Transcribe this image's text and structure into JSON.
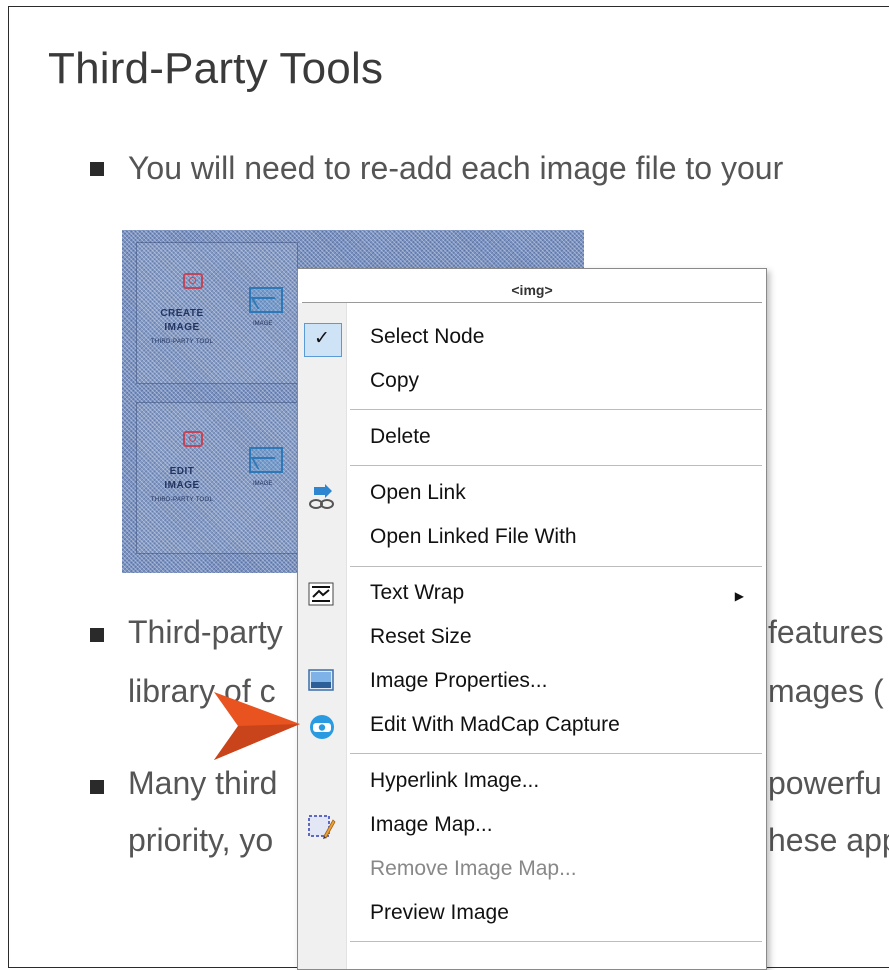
{
  "page": {
    "title": "Third-Party Tools",
    "bullets": [
      "You will need to re-add each image file to your",
      "Third-party",
      "features",
      "library of c",
      "mages (",
      "Many third",
      "powerfu",
      "priority, yo",
      "hese app"
    ]
  },
  "image": {
    "tile1_label_line1": "CREATE",
    "tile1_label_line2": "IMAGE",
    "tile1_sub": "THIRD-PARTY TOOL",
    "tile2_label_line1": "EDIT",
    "tile2_label_line2": "IMAGE",
    "tile2_sub": "THIRD-PARTY TOOL",
    "pic_caption": "IMAGE",
    "selection_color": "#7a93c2"
  },
  "context_menu": {
    "header": "<img>",
    "items": [
      {
        "label": "Select Node",
        "icon": "check-icon",
        "checked": true
      },
      {
        "label": "Copy"
      },
      {
        "label": "Delete"
      },
      {
        "label": "Open Link",
        "icon": "link-icon"
      },
      {
        "label": "Open Linked File With"
      },
      {
        "label": "Text Wrap",
        "icon": "text-wrap-icon",
        "submenu": true
      },
      {
        "label": "Reset Size"
      },
      {
        "label": "Image Properties...",
        "icon": "image-properties-icon"
      },
      {
        "label": "Edit With MadCap Capture",
        "icon": "madcap-capture-icon"
      },
      {
        "label": "Hyperlink Image..."
      },
      {
        "label": "Image Map...",
        "icon": "image-map-icon"
      },
      {
        "label": "Remove Image Map...",
        "disabled": true
      },
      {
        "label": "Preview Image"
      }
    ],
    "submenu_arrow": "▶"
  },
  "callout": {
    "icon": "orange-arrow-pointer-icon",
    "color": "#e8531f"
  }
}
